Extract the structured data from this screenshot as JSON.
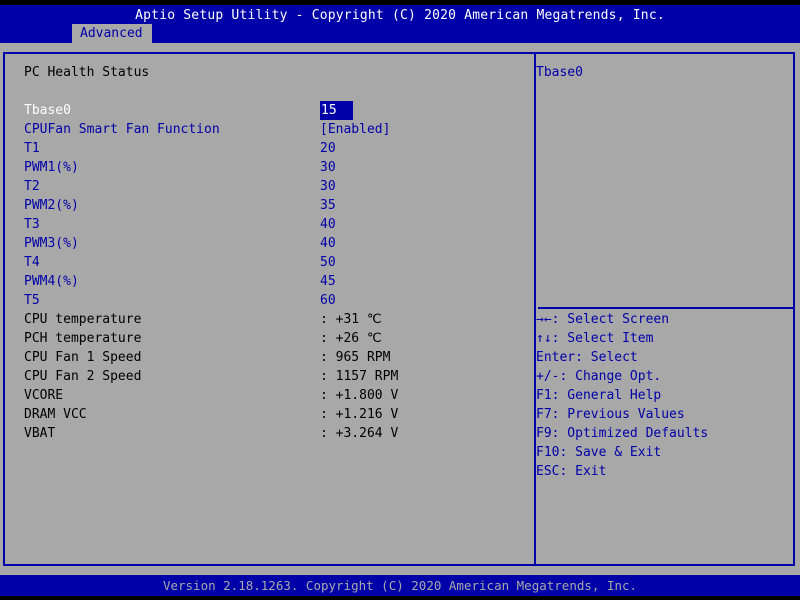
{
  "header": {
    "title": "Aptio Setup Utility - Copyright (C) 2020 American Megatrends, Inc.",
    "tabs": [
      {
        "label": "Advanced"
      }
    ]
  },
  "page": {
    "section_title": "PC Health Status",
    "selected": {
      "label": "Tbase0",
      "value": "15"
    },
    "settings": [
      {
        "label": "CPUFan Smart Fan Function",
        "value": "[Enabled]"
      },
      {
        "label": "T1",
        "value": "20"
      },
      {
        "label": "PWM1(%)",
        "value": "30"
      },
      {
        "label": "T2",
        "value": "30"
      },
      {
        "label": "PWM2(%)",
        "value": "35"
      },
      {
        "label": "T3",
        "value": "40"
      },
      {
        "label": "PWM3(%)",
        "value": "40"
      },
      {
        "label": "T4",
        "value": "50"
      },
      {
        "label": "PWM4(%)",
        "value": "45"
      },
      {
        "label": "T5",
        "value": "60"
      }
    ],
    "readings": [
      {
        "label": "CPU temperature",
        "value": ": +31 ℃"
      },
      {
        "label": "PCH temperature",
        "value": ": +26 ℃"
      },
      {
        "label": "CPU Fan 1 Speed",
        "value": ": 965 RPM"
      },
      {
        "label": "CPU Fan 2 Speed",
        "value": ": 1157 RPM"
      },
      {
        "label": "VCORE",
        "value": ": +1.800 V"
      },
      {
        "label": "DRAM VCC",
        "value": ": +1.216 V"
      },
      {
        "label": "VBAT",
        "value": ": +3.264 V"
      }
    ]
  },
  "help": {
    "description": "Tbase0",
    "keys": [
      "→←: Select Screen",
      "↑↓: Select Item",
      "Enter: Select",
      "+/-: Change Opt.",
      "F1: General Help",
      "F7: Previous Values",
      "F9: Optimized Defaults",
      "F10: Save & Exit",
      "ESC: Exit"
    ]
  },
  "footer": {
    "text": "Version 2.18.1263. Copyright (C) 2020 American Megatrends, Inc."
  }
}
